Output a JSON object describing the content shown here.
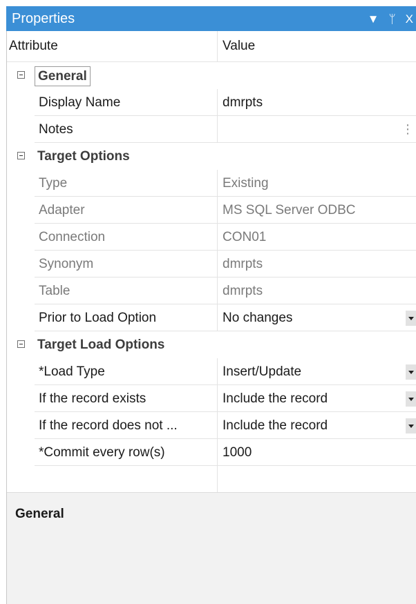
{
  "window": {
    "title": "Properties",
    "menu_icon": "dropdown-arrow-icon",
    "pin_icon": "pin-icon",
    "close_icon": "close-icon",
    "pin_glyph": "ᛘ",
    "close_glyph": "X"
  },
  "grid": {
    "header": {
      "attribute": "Attribute",
      "value": "Value"
    },
    "categories": {
      "general": {
        "label": "General",
        "rows": {
          "display_name": {
            "label": "Display Name",
            "value": "dmrpts"
          },
          "notes": {
            "label": "Notes",
            "value": "",
            "ellipsis": "⋮"
          }
        }
      },
      "target_options": {
        "label": "Target Options",
        "rows": {
          "type": {
            "label": "Type",
            "value": "Existing"
          },
          "adapter": {
            "label": "Adapter",
            "value": "MS SQL Server ODBC"
          },
          "connection": {
            "label": "Connection",
            "value": "CON01"
          },
          "synonym": {
            "label": "Synonym",
            "value": "dmrpts"
          },
          "table": {
            "label": "Table",
            "value": "dmrpts"
          },
          "prior_to_load": {
            "label": "Prior to Load Option",
            "value": "No changes"
          }
        }
      },
      "target_load_options": {
        "label": "Target Load Options",
        "rows": {
          "load_type": {
            "label": "*Load Type",
            "value": "Insert/Update"
          },
          "record_exists": {
            "label": "If the record exists",
            "value": "Include the record"
          },
          "record_not_exists": {
            "label": "If the record does not ...",
            "value": "Include the record"
          },
          "commit_every": {
            "label": "*Commit every row(s)",
            "value": "1000"
          }
        }
      }
    }
  },
  "description": {
    "title": "General"
  }
}
